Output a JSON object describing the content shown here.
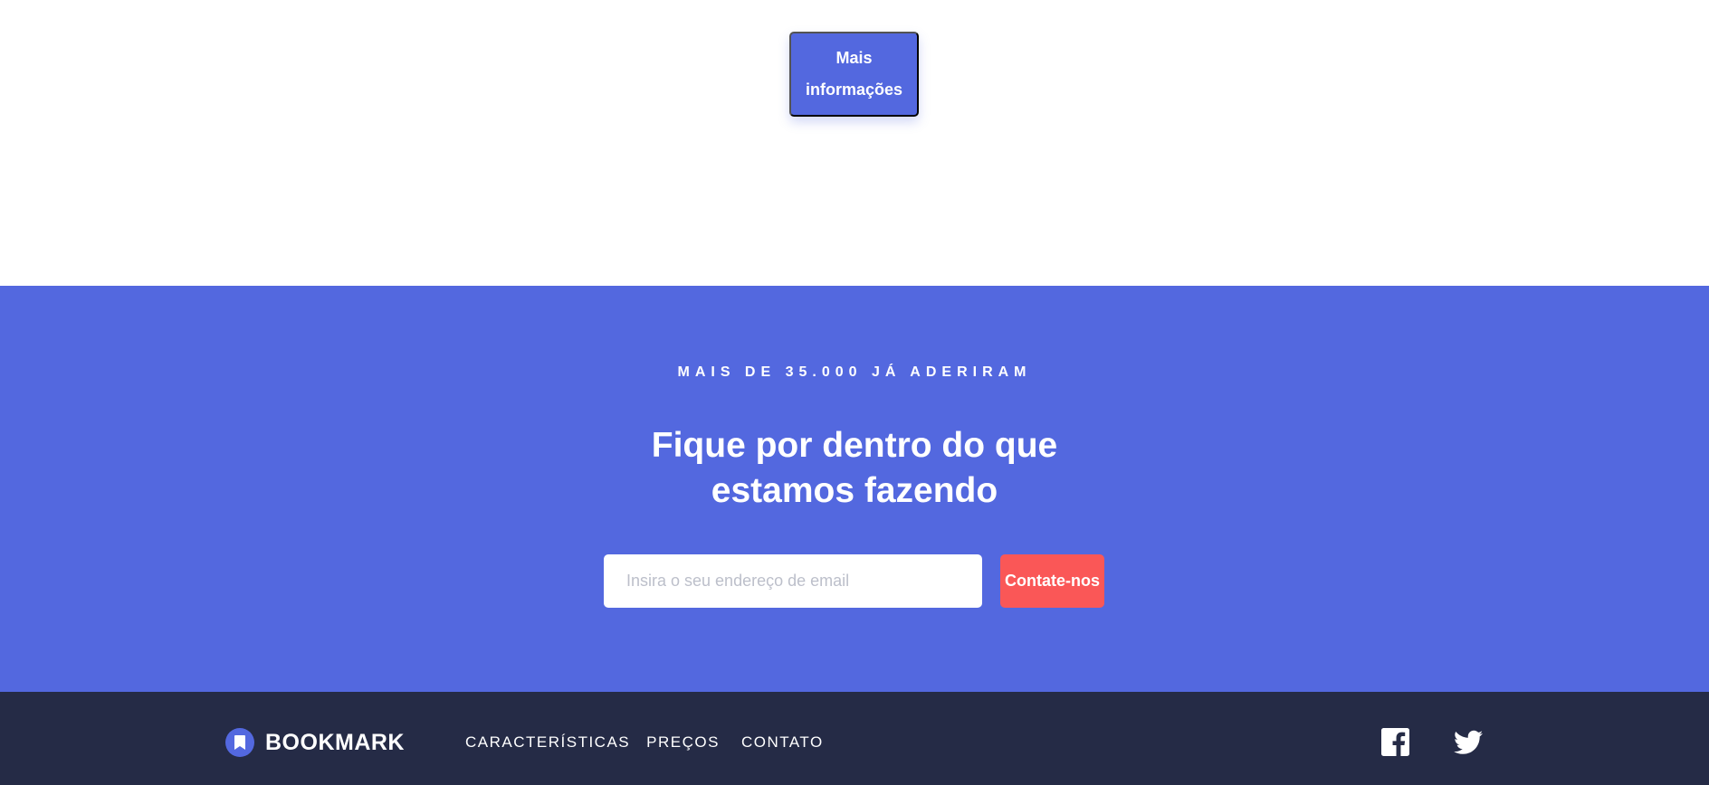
{
  "top": {
    "more_info_label": "Mais informações"
  },
  "cta": {
    "eyebrow": "MAIS DE 35.000 JÁ ADERIRAM",
    "heading": "Fique por dentro do que estamos fazendo",
    "email_placeholder": "Insira o seu endereço de email",
    "email_value": "",
    "submit_label": "Contate-nos"
  },
  "footer": {
    "logo_text": "BOOKMARK",
    "nav": [
      {
        "label": "CARACTERÍSTICAS"
      },
      {
        "label": "PREÇOS"
      },
      {
        "label": "CONTATO"
      }
    ],
    "social_icons": [
      "facebook-icon",
      "twitter-icon"
    ]
  },
  "colors": {
    "primary_blue": "#5368df",
    "accent_red": "#fa5757",
    "footer_navy": "#252b46",
    "white": "#ffffff"
  }
}
